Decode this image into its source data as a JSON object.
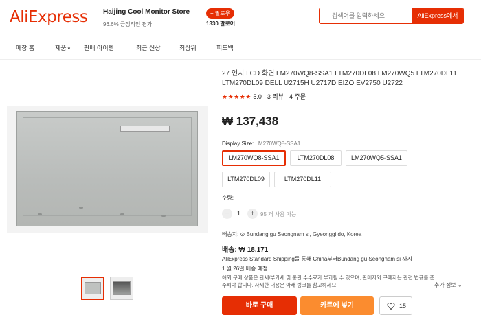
{
  "header": {
    "logo": "AliExpress",
    "store_name": "Haijing Cool Monitor Store",
    "store_rating": "96.6% 긍정적인 평가",
    "follow_label": "+ 팔로우",
    "followers": "1330 팔로어",
    "search_placeholder": "검색어를 입력하세요",
    "search_button": "AliExpress에서"
  },
  "nav": {
    "items": [
      "매장 홈",
      "제품",
      "판매 아이템",
      "최근 신상",
      "최상위",
      "피드백"
    ]
  },
  "product": {
    "title": "27 인치 LCD 화면 LM270WQ8-SSA1 LTM270DL08 LM270WQ5 LTM270DL11 LTM270DL09 DELL U2715H U2717D EIZO EV2750 U2722",
    "stars": "★★★★★",
    "rating": "5.0",
    "reviews": "3 리뷰",
    "orders": "4 주문",
    "price": "₩ 137,438",
    "option_label": "Display Size:",
    "option_selected": "LM270WQ8-SSA1",
    "options": [
      "LM270WQ8-SSA1",
      "LTM270DL08",
      "LM270WQ5-SSA1",
      "LTM270DL09",
      "LTM270DL11"
    ],
    "quantity_label": "수량:",
    "quantity": "1",
    "available": "95 개 사용 가능",
    "minus": "−",
    "plus": "+"
  },
  "shipping": {
    "ship_to_label": "배송지:",
    "ship_to_location": "Bundang gu Seongnam si, Gyeonggi do, Korea",
    "fee": "배송: ₩ 18,171",
    "method": "AliExpress Standard Shipping를 통해 China부터Bundang gu Seongnam si 까지",
    "date": "1 월 26일 배송 예정",
    "notice": "해외 구매 상품은 관세/부가세 및 통관 수수료가 부과될 수 있으며, 판매자와 구매자는 관련 법규를 준수해야 합니다. 자세한 내용은 아래 링크를 참고하세요.",
    "more": "추가 정보"
  },
  "actions": {
    "buy": "바로 구매",
    "cart": "카트에 넣기",
    "wishlist_count": "15"
  },
  "colors": {
    "accent": "#e62e04",
    "cart": "#fb8c2f"
  }
}
